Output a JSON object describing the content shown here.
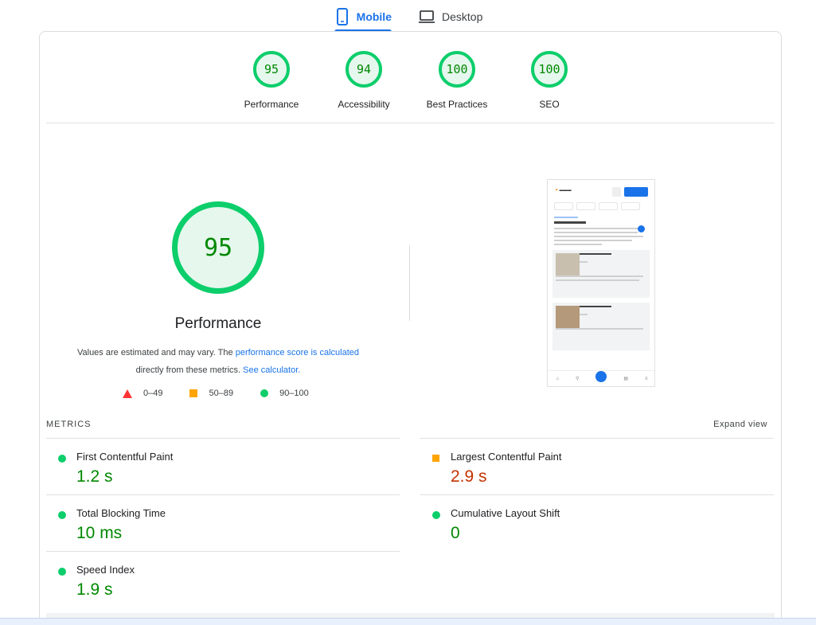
{
  "tabs": [
    {
      "label": "Mobile",
      "active": true,
      "icon": "smartphone-icon"
    },
    {
      "label": "Desktop",
      "active": false,
      "icon": "laptop-icon"
    }
  ],
  "gauges": [
    {
      "score": "95",
      "label": "Performance"
    },
    {
      "score": "94",
      "label": "Accessibility"
    },
    {
      "score": "100",
      "label": "Best Practices"
    },
    {
      "score": "100",
      "label": "SEO"
    }
  ],
  "performance": {
    "score": "95",
    "title": "Performance",
    "note_prefix": "Values are estimated and may vary. The ",
    "note_link1": "performance score is calculated",
    "note_middle": "directly from these metrics. ",
    "note_link2": "See calculator."
  },
  "legend": [
    {
      "range": "0–49",
      "shape": "triangle",
      "color": "#ff3333"
    },
    {
      "range": "50–89",
      "shape": "square",
      "color": "#ffa400"
    },
    {
      "range": "90–100",
      "shape": "circle",
      "color": "#0cce6b"
    }
  ],
  "metrics": {
    "label": "METRICS",
    "expand_label": "Expand view",
    "items": [
      {
        "name": "First Contentful Paint",
        "value": "1.2 s",
        "status": "pass"
      },
      {
        "name": "Largest Contentful Paint",
        "value": "2.9 s",
        "status": "average"
      },
      {
        "name": "Total Blocking Time",
        "value": "10 ms",
        "status": "pass"
      },
      {
        "name": "Cumulative Layout Shift",
        "value": "0",
        "status": "pass"
      },
      {
        "name": "Speed Index",
        "value": "1.9 s",
        "status": "pass"
      }
    ]
  },
  "colors": {
    "accent": "#1a73e8",
    "pass": "#0cce6b",
    "pass_text": "#008800",
    "average": "#ffa400",
    "average_text": "#c33300",
    "fail": "#ff3333"
  }
}
